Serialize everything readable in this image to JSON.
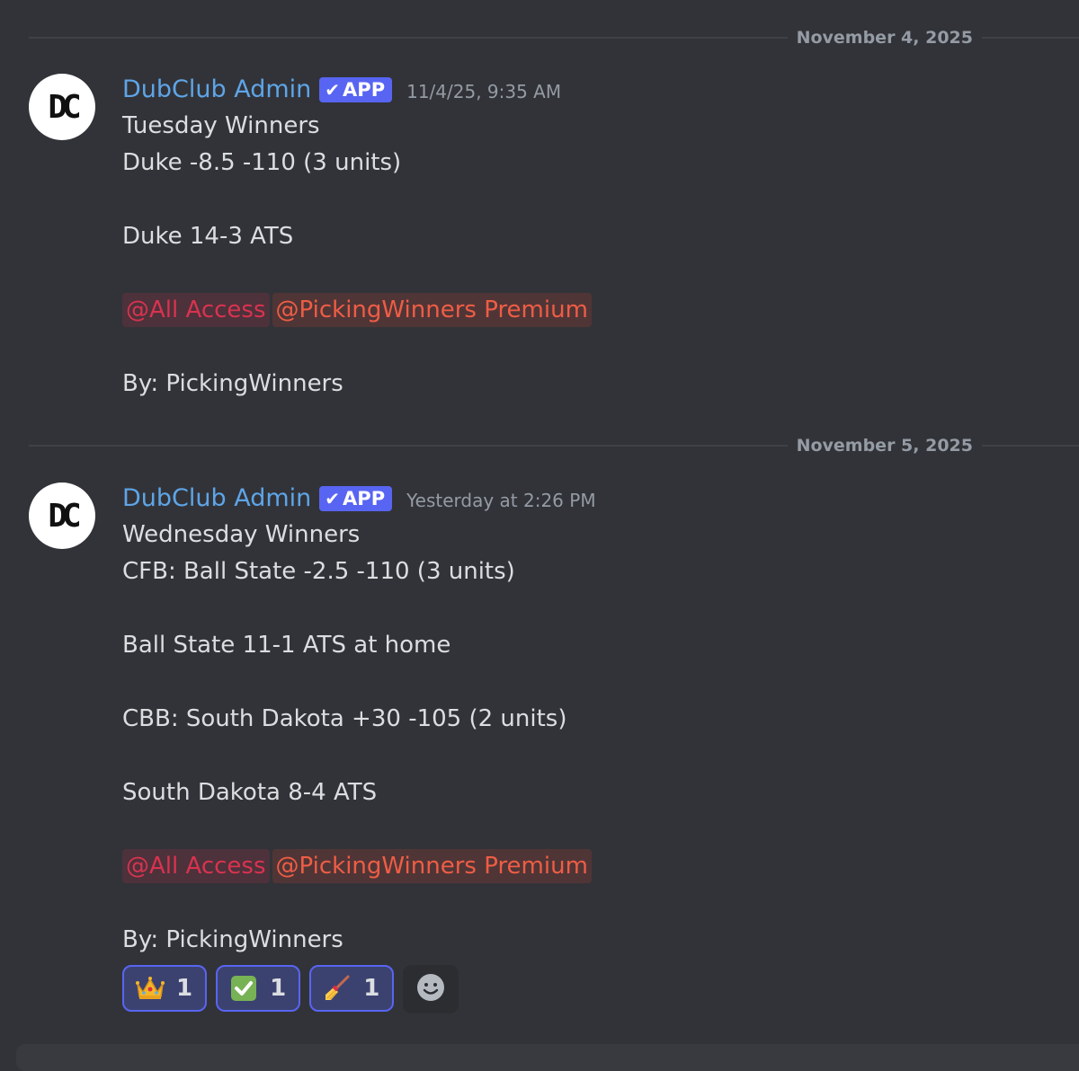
{
  "dividers": [
    {
      "label": "November 4, 2025"
    },
    {
      "label": "November 5, 2025"
    }
  ],
  "messages": [
    {
      "avatar_text": "DC",
      "username": "DubClub Admin",
      "badge": "APP",
      "timestamp": "11/4/25, 9:35 AM",
      "lines": [
        "Tuesday Winners",
        "Duke -8.5 -110 (3 units)",
        "",
        "Duke 14-3 ATS",
        ""
      ],
      "mentions": [
        "@All Access",
        "@PickingWinners Premium"
      ],
      "byline": "By: PickingWinners"
    },
    {
      "avatar_text": "DC",
      "username": "DubClub Admin",
      "badge": "APP",
      "timestamp": "Yesterday at 2:26 PM",
      "lines": [
        "Wednesday Winners",
        "CFB: Ball State -2.5 -110 (3 units)",
        "",
        "Ball State 11-1 ATS at home",
        "",
        "CBB: South Dakota +30 -105 (2 units)",
        "",
        "South Dakota 8-4 ATS",
        ""
      ],
      "mentions": [
        "@All Access",
        "@PickingWinners Premium"
      ],
      "byline": "By: PickingWinners"
    }
  ],
  "reactions": [
    {
      "emoji": "crown",
      "count": "1"
    },
    {
      "emoji": "check-mark",
      "count": "1"
    },
    {
      "emoji": "broom",
      "count": "1"
    }
  ],
  "colors": {
    "background": "#323338",
    "username": "#5ea5e8",
    "badge": "#5865f2",
    "mention_all": "#d8334f",
    "mention_premium": "#ee5d45",
    "timestamp": "#949ba4"
  }
}
